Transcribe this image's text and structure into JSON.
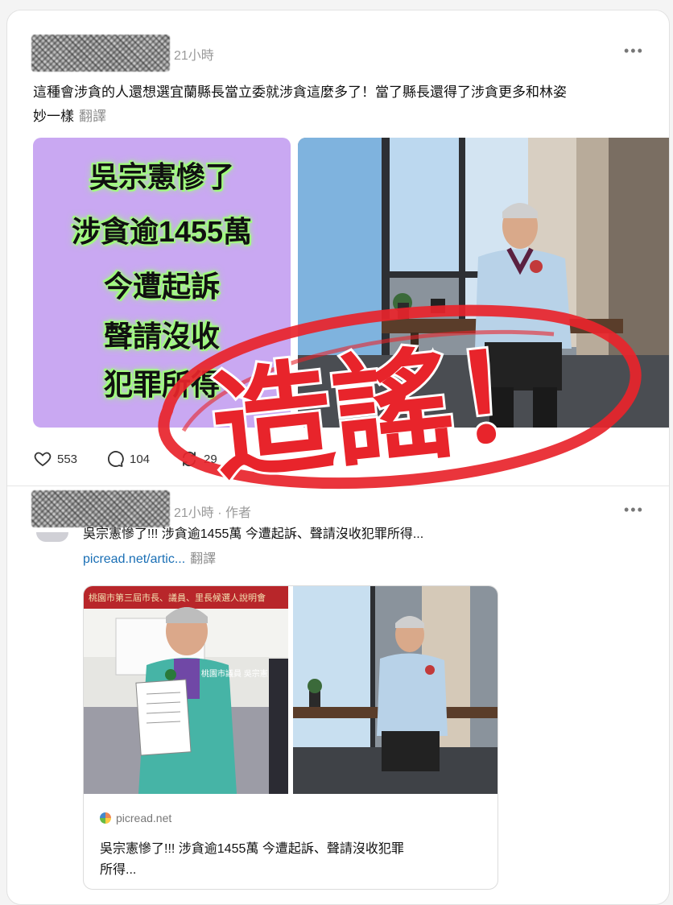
{
  "post1": {
    "time": "21小時",
    "more_icon": "more-horizontal-icon",
    "text": "這種會涉貪的人還想選宜蘭縣長當立委就涉貪這麼多了！當了縣長還得了涉貪更多和林姿妙一樣",
    "text_line1": "這種會涉貪的人還想選宜蘭縣長當立委就涉貪這麼多了！當了縣長還得了涉貪更多和林姿",
    "text_line2": "妙一樣",
    "translate": "翻譯",
    "image_headline": [
      "吳宗憲慘了",
      "涉貪逾1455萬",
      "今遭起訴",
      "聲請沒收",
      "犯罪所得"
    ],
    "likes": "553",
    "comments": "104",
    "reposts": "29"
  },
  "stamp": {
    "text": "造謠！",
    "color": "#e8242b"
  },
  "post2": {
    "time_author": "21小時 · 作者",
    "text": "吳宗憲慘了!!! 涉貪逾1455萬 今遭起訴、聲請沒收犯罪所得...",
    "link": "picread.net/artic...",
    "translate": "翻譯",
    "banner_text": "桃園市第三屆市長、議員、里長候選人說明會",
    "vest_text": "桃園市議員 吳宗憲",
    "card_domain": "picread.net",
    "card_title_line1": "吳宗憲慘了!!! 涉貪逾1455萬 今遭起訴、聲請沒收犯罪",
    "card_title_line2": "所得..."
  },
  "colors": {
    "link": "#1a6fb5",
    "news_bg": "#c9a8f2",
    "stamp_red": "#e8242b"
  }
}
